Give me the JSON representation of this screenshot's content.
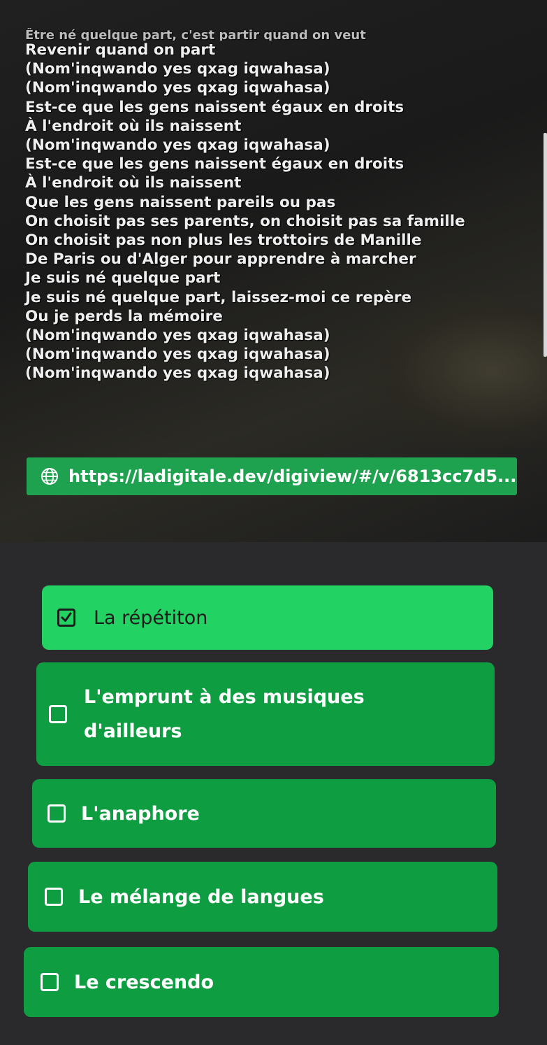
{
  "video": {
    "lyrics": [
      "Être né quelque part, c'est partir quand on veut",
      "Revenir quand on part",
      "(Nom'inqwando yes qxag iqwahasa)",
      "(Nom'inqwando yes qxag iqwahasa)",
      "Est-ce que les gens naissent égaux en droits",
      "À l'endroit où ils naissent",
      "(Nom'inqwando yes qxag iqwahasa)",
      "Est-ce que les gens naissent égaux en droits",
      "À l'endroit où ils naissent",
      "Que les gens naissent pareils ou pas",
      "On choisit pas ses parents, on choisit pas sa famille",
      "On choisit pas non plus les trottoirs de Manille",
      "De Paris ou d'Alger pour apprendre à marcher",
      "Je suis né quelque part",
      "Je suis né quelque part, laissez-moi ce repère",
      "Ou je perds la mémoire",
      "(Nom'inqwando yes qxag iqwahasa)",
      "(Nom'inqwando yes qxag iqwahasa)",
      "(Nom'inqwando yes qxag iqwahasa)"
    ],
    "url": "https://ladigitale.dev/digiview/#/v/6813cc7d5...",
    "url_icon": "globe-icon"
  },
  "options": [
    {
      "label": "La répétiton",
      "checked": true
    },
    {
      "label": "L'emprunt à des musiques d'ailleurs",
      "checked": false
    },
    {
      "label": "L'anaphore",
      "checked": false
    },
    {
      "label": "Le mélange de langues",
      "checked": false
    },
    {
      "label": "Le crescendo",
      "checked": false
    }
  ],
  "colors": {
    "option_selected": "#22d364",
    "option_default": "#0f9d42",
    "url_bar": "#1fa24f",
    "background": "#2a2a2c"
  }
}
